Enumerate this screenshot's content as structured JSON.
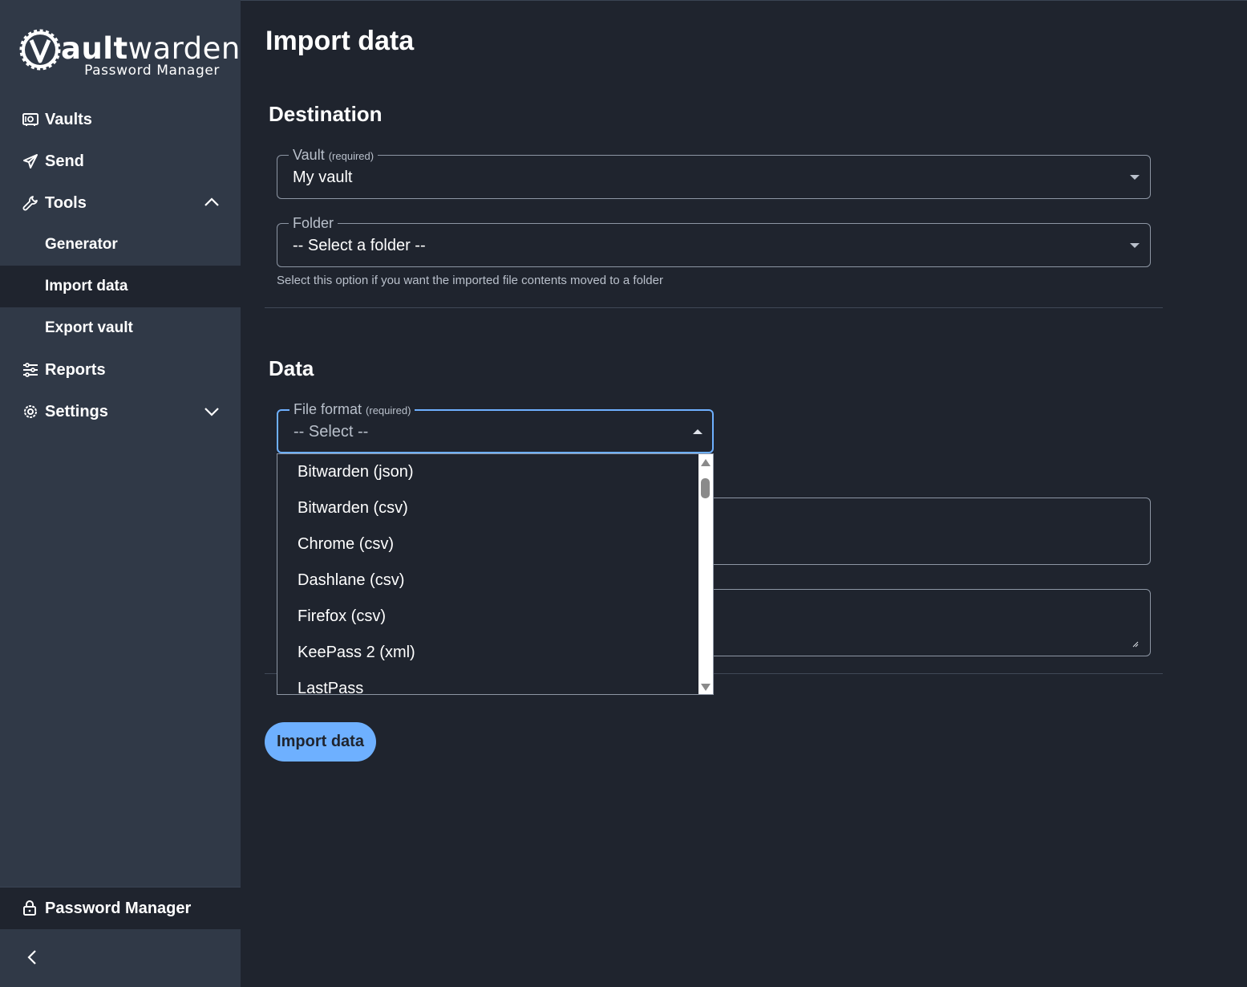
{
  "brand": {
    "word_bold": "ault",
    "word_light": "warden",
    "subtitle": "Password Manager"
  },
  "sidebar": {
    "items": [
      {
        "label": "Vaults",
        "icon": "vault-icon"
      },
      {
        "label": "Send",
        "icon": "paper-plane-icon"
      },
      {
        "label": "Tools",
        "icon": "wrench-icon",
        "expanded": true
      },
      {
        "label": "Generator"
      },
      {
        "label": "Import data",
        "active": true
      },
      {
        "label": "Export vault"
      },
      {
        "label": "Reports",
        "icon": "sliders-icon"
      },
      {
        "label": "Settings",
        "icon": "gear-icon",
        "expanded": false
      }
    ],
    "footer_label": "Password Manager"
  },
  "page": {
    "title": "Import data",
    "destination_heading": "Destination",
    "vault_label": "Vault",
    "vault_required": "(required)",
    "vault_value": "My vault",
    "folder_label": "Folder",
    "folder_value": "-- Select a folder --",
    "folder_hint": "Select this option if you want the imported file contents moved to a folder",
    "data_heading": "Data",
    "format_label": "File format",
    "format_required": "(required)",
    "format_value": "-- Select --",
    "format_options": [
      "Bitwarden (json)",
      "Bitwarden (csv)",
      "Chrome (csv)",
      "Dashlane (csv)",
      "Firefox (csv)",
      "KeePass 2 (xml)",
      "LastPass"
    ],
    "import_button": "Import data"
  },
  "colors": {
    "background": "#1f242e",
    "sidebar": "#303947",
    "accent": "#6eb0ff",
    "muted_text": "#b9c0cb"
  }
}
